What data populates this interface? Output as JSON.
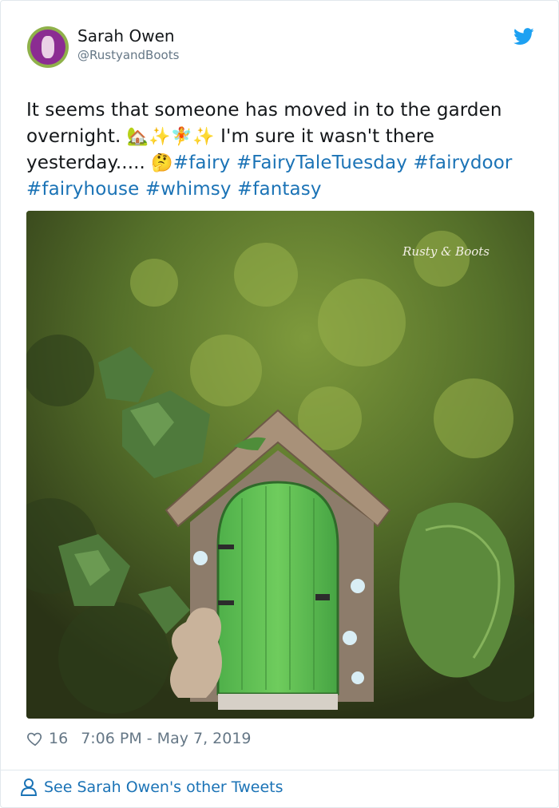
{
  "author": {
    "name": "Sarah Owen",
    "handle": "@RustyandBoots"
  },
  "tweet": {
    "text_1": "It seems that someone has moved in to the garden overnight. ",
    "emoji_1": "🏡✨🧚✨",
    "text_2": " I'm sure it wasn't there yesterday..... ",
    "emoji_2": "🤔",
    "hashtags": [
      "#fairy",
      "#FairyTaleTuesday",
      "#fairydoor",
      "#fairyhouse",
      "#whimsy",
      "#fantasy"
    ]
  },
  "image": {
    "watermark": "Rusty & Boots"
  },
  "stats": {
    "likes": "16",
    "timestamp": "7:06 PM - May 7, 2019"
  },
  "footer": {
    "link_label": "See Sarah Owen's other Tweets"
  },
  "icons": {
    "brand": "twitter-bird-icon",
    "like": "heart-icon",
    "profile": "person-icon"
  },
  "colors": {
    "link": "#1b73b6",
    "twitter": "#1da1f2",
    "secondary_text": "#657786"
  }
}
